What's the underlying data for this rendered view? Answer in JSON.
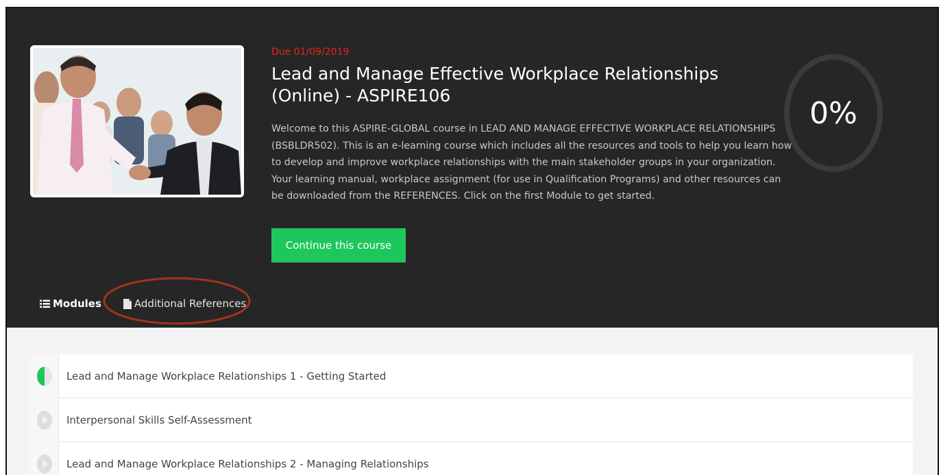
{
  "course": {
    "due": "Due 01/09/2019",
    "title": "Lead and Manage Effective Workplace Relationships (Online) - ASPIRE106",
    "description": "Welcome to this ASPIRE-GLOBAL course in LEAD AND MANAGE EFFECTIVE WORKPLACE RELATIONSHIPS (BSBLDR502). This is an e-learning course which includes all the resources and tools to help you learn how to develop and improve workplace relationships with the main stakeholder groups in your organization. Your learning manual, workplace assignment (for use in Qualification Programs) and other resources can be downloaded from the REFERENCES. Click on the first Module to get started.",
    "continue_label": "Continue this course",
    "progress_label": "0%",
    "progress_fraction": 0
  },
  "tabs": {
    "modules": "Modules",
    "references": "Additional References"
  },
  "modules": [
    {
      "label": "Lead and Manage Workplace Relationships 1 - Getting Started",
      "status": "in-progress"
    },
    {
      "label": "Interpersonal Skills Self-Assessment",
      "status": "not-started"
    },
    {
      "label": "Lead and Manage Workplace Relationships 2 - Managing Relationships",
      "status": "not-started"
    }
  ],
  "colors": {
    "hero_bg": "#262626",
    "accent_green": "#1ec75c",
    "due_red": "#e8231b",
    "annotation_ring": "#a3321f"
  },
  "icons": {
    "modules_tab": "list-icon",
    "references_tab": "document-icon",
    "status_in_progress": "half-circle-progress-icon",
    "status_not_started": "play-circle-icon"
  }
}
